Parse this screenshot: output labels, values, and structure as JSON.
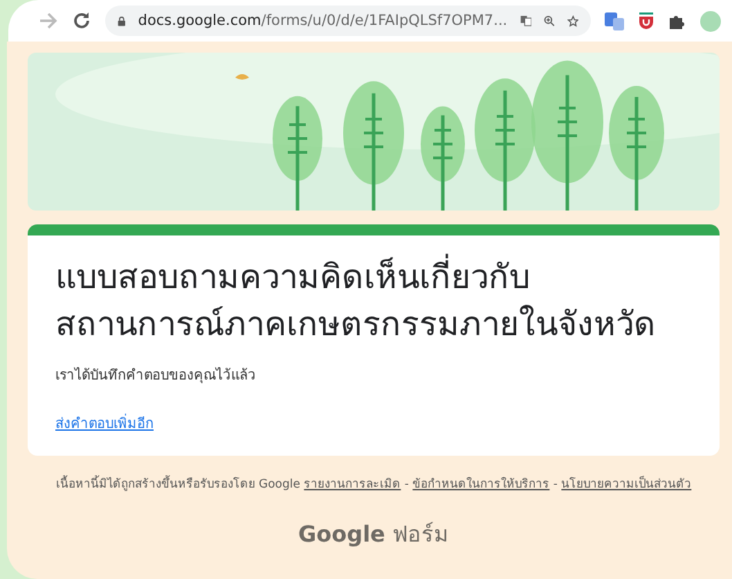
{
  "browser": {
    "forward_disabled": true,
    "url_host": "docs.google.com",
    "url_path": "/forms/u/0/d/e/1FAIpQLSf7OPM7..."
  },
  "form": {
    "title": "แบบสอบถามความคิดเห็นเกี่ยวกับสถานการณ์ภาคเกษตรกรรมภายในจังหวัด",
    "message": "เราได้บันทึกคำตอบของคุณไว้แล้ว",
    "link": "ส่งคำตอบเพิ่มอีก"
  },
  "footer": {
    "separator": "-",
    "notice": "เนื้อหานี้มิได้ถูกสร้างขึ้นหรือรับรองโดย Google",
    "links": [
      "รายงานการละเมิด",
      "ข้อกำหนดในการให้บริการ",
      "นโยบายความเป็นส่วนตัว"
    ]
  },
  "brand": {
    "name": "Google",
    "product": "ฟอร์ม"
  }
}
